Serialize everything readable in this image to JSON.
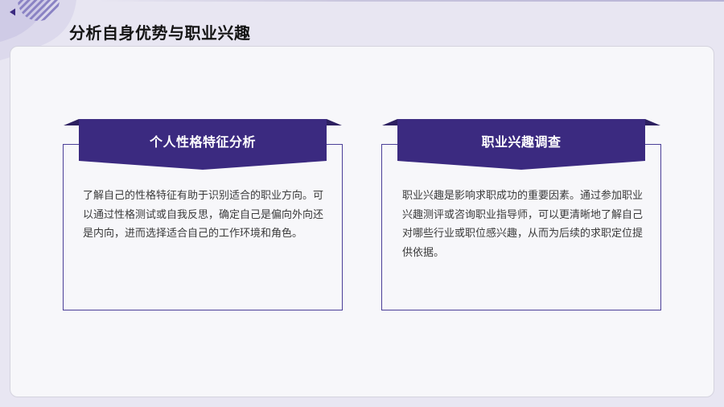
{
  "page": {
    "title": "分析自身优势与职业兴趣"
  },
  "colors": {
    "accent": "#3b2a80",
    "accent_dark": "#2d2060",
    "border": "#4b3f98",
    "panel_bg": "#f7f7fa",
    "page_bg": "#e8e6f2"
  },
  "cards": [
    {
      "title": "个人性格特征分析",
      "body": "了解自己的性格特征有助于识别适合的职业方向。可以通过性格测试或自我反思，确定自己是偏向外向还是内向，进而选择适合自己的工作环境和角色。"
    },
    {
      "title": "职业兴趣调查",
      "body": "职业兴趣是影响求职成功的重要因素。通过参加职业兴趣测评或咨询职业指导师，可以更清晰地了解自己对哪些行业或职位感兴趣，从而为后续的求职定位提供依据。"
    }
  ]
}
